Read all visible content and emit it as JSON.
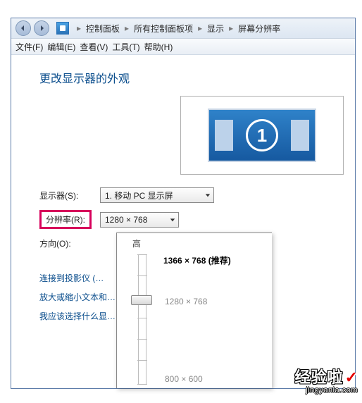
{
  "titlebar": {
    "crumbs": [
      "控制面板",
      "所有控制面板项",
      "显示",
      "屏幕分辨率"
    ]
  },
  "menubar": {
    "items": [
      "文件(F)",
      "编辑(E)",
      "查看(V)",
      "工具(T)",
      "帮助(H)"
    ]
  },
  "content": {
    "heading": "更改显示器的外观",
    "monitor_number": "1",
    "display_label": "显示器(S):",
    "display_value": "1. 移动 PC 显示屏",
    "resolution_label": "分辨率(R):",
    "resolution_value": "1280 × 768",
    "orientation_label": "方向(O):"
  },
  "links": {
    "projector": "连接到投影仪 (…",
    "enlarge": "放大或缩小文本和…",
    "which": "我应该选择什么显…"
  },
  "popup": {
    "top_label": "高",
    "option_recommended": "1366 × 768 (推荐)",
    "option_mid": "1280 × 768",
    "option_low": "800 × 600"
  },
  "watermark": {
    "brand": "经验啦",
    "check": "✓",
    "url": "jingyanla.com"
  }
}
